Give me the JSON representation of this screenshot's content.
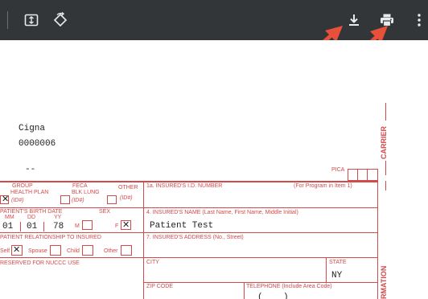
{
  "insurer": {
    "name": "Cigna",
    "code": "0000006",
    "dash": "--"
  },
  "labels": {
    "pica": "PICA",
    "group_health_plan": "GROUP\nHEALTH PLAN",
    "group_idno": "(ID#)",
    "feca": "FECA\nBLK LUNG",
    "feca_idno": "(ID#)",
    "other": "OTHER",
    "other_idno": "(ID#)",
    "insured_id": "1a. INSURED'S I.D. NUMBER",
    "program_note": "(For Program in Item 1)",
    "patient_birth_date": "PATIENT'S BIRTH DATE",
    "mm": "MM",
    "dd": "DD",
    "yy": "YY",
    "sex": "SEX",
    "m": "M",
    "f": "F",
    "insured_name": "4. INSURED'S NAME (Last Name, First Name, Middle Initial)",
    "patient_relationship": "PATIENT RELATIONSHIP TO INSURED",
    "self": "Self",
    "spouse": "Spouse",
    "child": "Child",
    "other_rel": "Other",
    "insured_address": "7. INSURED'S ADDRESS (No., Street)",
    "reserved": "RESERVED FOR NUCCC USE",
    "city": "CITY",
    "state": "STATE",
    "zip": "ZIP CODE",
    "telephone": "TELEPHONE (Include Area Code)",
    "carrier": "CARRIER",
    "information": "RMATION"
  },
  "values": {
    "birth_mm": "01",
    "birth_dd": "01",
    "birth_yy": "78",
    "insured_name": "Patient Test",
    "state": "NY",
    "phone_open": "(",
    "phone_close": ")"
  },
  "colors": {
    "toolbar": "#323639",
    "form_red": "#d24a4a",
    "arrow_red": "#e8503a"
  }
}
